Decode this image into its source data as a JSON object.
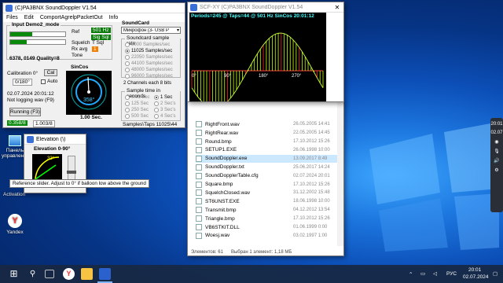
{
  "main_window": {
    "title": "(C)PA3BNX SoundDoppler V1.54",
    "menu": [
      "Files",
      "Edit",
      "ComportAgrelpPacketOut",
      "Info"
    ],
    "input_group": "Input Demo2_mode",
    "ref_label": "Ref",
    "ref_value": "501 Hz",
    "sig_value": "Sig Sql",
    "squelch_label": "Squelch",
    "squelch_value": "T Sql",
    "rxavg_label": "Rx avg",
    "rxavg_value": "1",
    "tone_label": "Tone",
    "numbers_line": "6378, 0149 Quality=8",
    "calibration_label": "Calibration 0°",
    "cal_button": "Cal",
    "cal_value": "0/180°",
    "auto_label": "Auto",
    "timestamp": "02.07.2024 20:01:12",
    "not_logging": "Not logging wav (F9)",
    "sincos_label": "SinCos",
    "degrees": "358°",
    "sec_label": "1.00 Sec.",
    "running_button": "Running (F3)",
    "status_left": "0.358/8",
    "status_right": "1.003/8",
    "soundcard_group": "SoundCard",
    "device_select": "Микрофон (3- USB P",
    "sample_rate_group": "Soundcard sample rate",
    "sample_rates": [
      "8000 Samples/sec",
      "11025 Samples/sec",
      "22050 Samples/sec",
      "44100 Samples/sec",
      "48000 Samples/sec",
      "96000 Samples/sec"
    ],
    "selected_rate": "11025 Samples/sec",
    "channels_note": "2 Channels each 8 bits",
    "sample_time_group": "Sample time in seconds",
    "sample_times_left": [
      "0.01 Sec",
      "125 Sec",
      "250 Sec",
      "500 Sec"
    ],
    "sample_times_right": [
      "1 Sec",
      "2 Sec's",
      "3 Sec's",
      "4 Sec's"
    ],
    "samples_taps": "Samples\\Taps 11025\\44"
  },
  "scope_window": {
    "title": "SCF-XY (C)PA3BNX SoundDoppler V1.54",
    "header_text": "Periods=245 @ Taps=44 @ 501 Hz SinCos 20:01:12",
    "angle_labels": [
      "0°",
      "90°",
      "180°",
      "270°"
    ],
    "wave": {
      "amplitude": 1,
      "periods": 1,
      "offset_deg": 90,
      "stem_color": "#c8ff00",
      "stem_accent": "#ff2020",
      "axis_color": "#ff4040"
    }
  },
  "explorer": {
    "rows": [
      {
        "name": "RightFront.wav",
        "date": "26.05.2005 14:41"
      },
      {
        "name": "RightRear.wav",
        "date": "22.05.2005 14:45"
      },
      {
        "name": "Round.bmp",
        "date": "17.10.2012 15:26"
      },
      {
        "name": "SETUP1.EXE",
        "date": "26.06.1998 10:00"
      },
      {
        "name": "SoundDoppler.exe",
        "date": "13.09.2017 8:49",
        "selected": true
      },
      {
        "name": "SoundDoppler.txt",
        "date": "25.06.2017 14:24"
      },
      {
        "name": "SoundDopplerTable.cfg",
        "date": "02.07.2024 20:01"
      },
      {
        "name": "Square.bmp",
        "date": "17.10.2012 15:26"
      },
      {
        "name": "SquelchClosed.wav",
        "date": "31.12.2002 15:48"
      },
      {
        "name": "ST6UNST.EXE",
        "date": "18.06.1998 10:00"
      },
      {
        "name": "Transmit.bmp",
        "date": "04.12.2012 13:54"
      },
      {
        "name": "Triangle.bmp",
        "date": "17.10.2012 15:26"
      },
      {
        "name": "VB6STKIT.DLL",
        "date": "01.06.1999 0:00"
      },
      {
        "name": "Woesj.wav",
        "date": "03.02.1997 1:00"
      }
    ],
    "status_count": "Элементов: 61",
    "status_selected": "Выбран 1 элемент: 1,18 МБ"
  },
  "elevation_window": {
    "title": "Elevation (\\)",
    "label": "Elevation 0-90°",
    "value": "33°",
    "tooltip": "Reference slider. Adjust to 0° if balloon low above the ground"
  },
  "desktop": {
    "icons": [
      {
        "label": "Панель управления"
      },
      {
        "label": "Yandex"
      }
    ],
    "activation_text": "Activation"
  },
  "taskbar": {
    "lang": "РУС",
    "time": "20:01",
    "date": "02.07.2024"
  },
  "side_rail": {
    "time": "20:01",
    "date": "02.07"
  }
}
